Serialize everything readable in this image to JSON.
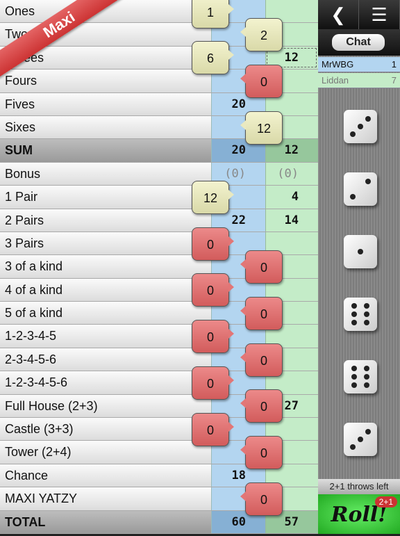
{
  "ribbon": "Maxi",
  "rows": [
    {
      "label": "Ones",
      "p1": "",
      "p2": "",
      "bubble": {
        "value": "1",
        "color": "yellow",
        "side": "left"
      }
    },
    {
      "label": "Twos",
      "p1": "",
      "p2": "",
      "bubble": {
        "value": "2",
        "color": "yellow",
        "side": "right"
      }
    },
    {
      "label": "Threes",
      "p1": "",
      "p2": "12",
      "p2_pending": true,
      "bubble": {
        "value": "6",
        "color": "yellow",
        "side": "left"
      }
    },
    {
      "label": "Fours",
      "p1": "",
      "p2": "",
      "bubble": {
        "value": "0",
        "color": "red",
        "side": "right"
      }
    },
    {
      "label": "Fives",
      "p1": "20",
      "p2": ""
    },
    {
      "label": "Sixes",
      "p1": "",
      "p2": "",
      "bubble": {
        "value": "12",
        "color": "yellow",
        "side": "right"
      }
    },
    {
      "label": "SUM",
      "p1": "20",
      "p2": "12",
      "total": true
    },
    {
      "label": "Bonus",
      "p1": "(0)",
      "p2": "(0)",
      "muted": true
    },
    {
      "label": "1 Pair",
      "p1": "",
      "p2": "4",
      "bubble": {
        "value": "12",
        "color": "yellow",
        "side": "left"
      }
    },
    {
      "label": "2 Pairs",
      "p1": "22",
      "p2": "14"
    },
    {
      "label": "3 Pairs",
      "p1": "",
      "p2": "",
      "bubble": {
        "value": "0",
        "color": "red",
        "side": "left"
      }
    },
    {
      "label": "3 of a kind",
      "p1": "",
      "p2": "",
      "bubble": {
        "value": "0",
        "color": "red",
        "side": "right"
      }
    },
    {
      "label": "4 of a kind",
      "p1": "",
      "p2": "",
      "bubble": {
        "value": "0",
        "color": "red",
        "side": "left"
      }
    },
    {
      "label": "5 of a kind",
      "p1": "",
      "p2": "",
      "bubble": {
        "value": "0",
        "color": "red",
        "side": "right"
      }
    },
    {
      "label": "1-2-3-4-5",
      "p1": "",
      "p2": "",
      "bubble": {
        "value": "0",
        "color": "red",
        "side": "left"
      }
    },
    {
      "label": "2-3-4-5-6",
      "p1": "",
      "p2": "",
      "bubble": {
        "value": "0",
        "color": "red",
        "side": "right"
      }
    },
    {
      "label": "1-2-3-4-5-6",
      "p1": "",
      "p2": "",
      "bubble": {
        "value": "0",
        "color": "red",
        "side": "left"
      }
    },
    {
      "label": "Full House (2+3)",
      "p1": "",
      "p2": "27",
      "bubble": {
        "value": "0",
        "color": "red",
        "side": "right"
      }
    },
    {
      "label": "Castle (3+3)",
      "p1": "",
      "p2": "",
      "bubble": {
        "value": "0",
        "color": "red",
        "side": "left"
      }
    },
    {
      "label": "Tower (2+4)",
      "p1": "",
      "p2": "",
      "bubble": {
        "value": "0",
        "color": "red",
        "side": "right"
      }
    },
    {
      "label": "Chance",
      "p1": "18",
      "p2": ""
    },
    {
      "label": "MAXI YATZY",
      "p1": "",
      "p2": "",
      "bubble": {
        "value": "0",
        "color": "red",
        "side": "right"
      }
    },
    {
      "label": "TOTAL",
      "p1": "60",
      "p2": "57",
      "total": true
    }
  ],
  "toolbar": {
    "back_icon": "chevron-left",
    "menu_icon": "list",
    "chat_label": "Chat"
  },
  "players": [
    {
      "name": "MrWBG",
      "score": "1",
      "color": "#b3d5f0"
    },
    {
      "name": "Liddan",
      "score": "7",
      "color": "#c4ecc8"
    }
  ],
  "dice": [
    3,
    2,
    1,
    6,
    6,
    3
  ],
  "throws_left": "2+1 throws left",
  "roll_label": "Roll!",
  "roll_badge": "2+1"
}
